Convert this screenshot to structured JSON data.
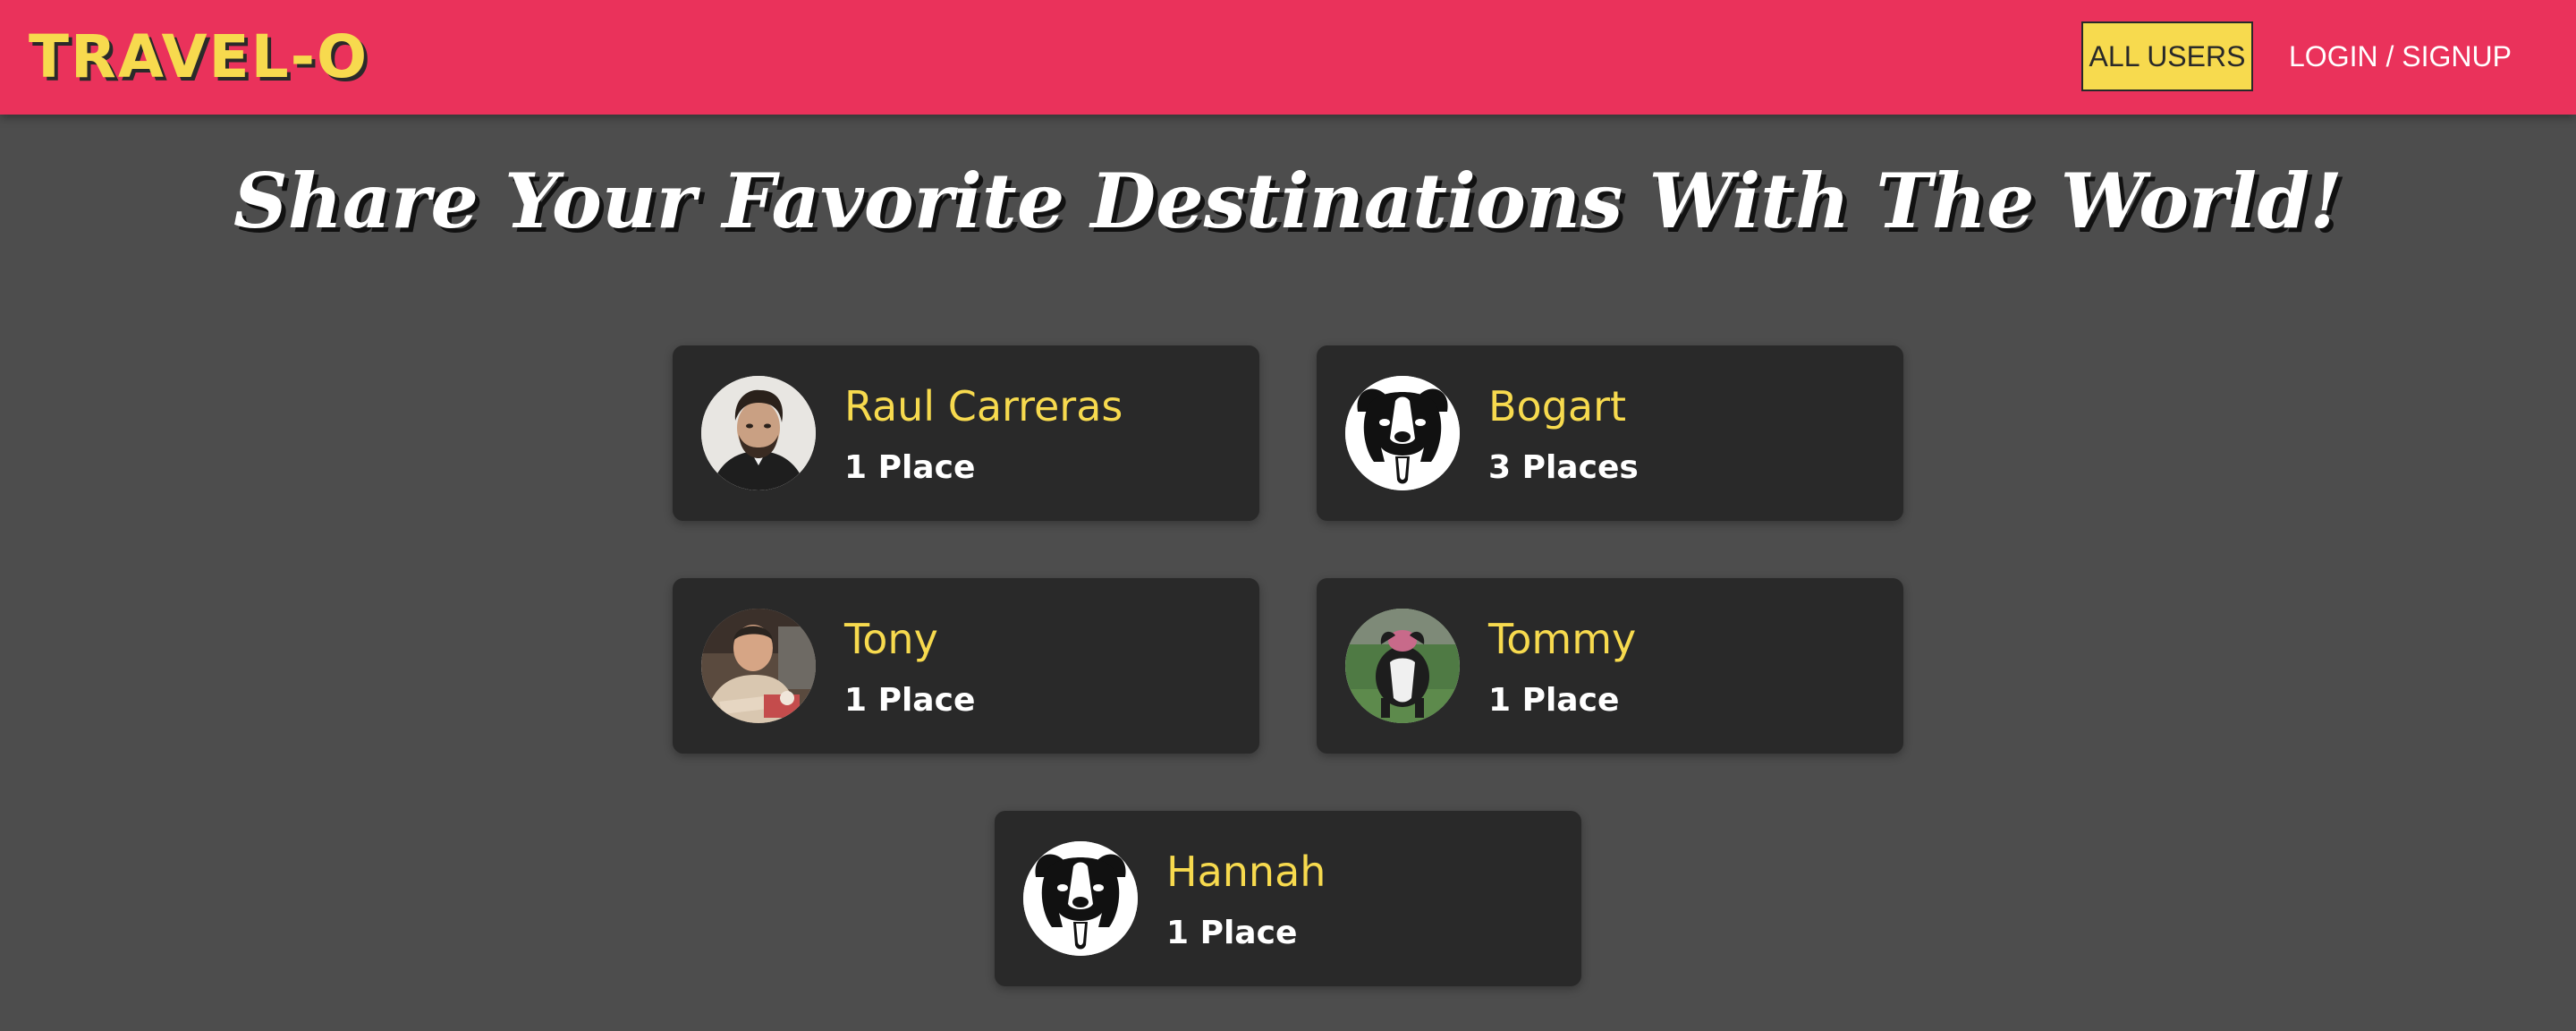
{
  "header": {
    "logo": "TRAVEL-O",
    "nav": {
      "all_users": "ALL USERS",
      "login_signup": "LOGIN / SIGNUP"
    }
  },
  "main": {
    "title": "Share Your Favorite Destinations With The World!",
    "users": [
      {
        "name": "Raul Carreras",
        "places": "1 Place",
        "avatar": "man-photo"
      },
      {
        "name": "Bogart",
        "places": "3 Places",
        "avatar": "dog-logo"
      },
      {
        "name": "Tony",
        "places": "1 Place",
        "avatar": "man-photo"
      },
      {
        "name": "Tommy",
        "places": "1 Place",
        "avatar": "dog-photo"
      },
      {
        "name": "Hannah",
        "places": "1 Place",
        "avatar": "dog-logo"
      }
    ]
  },
  "colors": {
    "header_bg": "#ea325b",
    "accent_yellow": "#f7da4e",
    "page_bg": "#4d4d4d",
    "card_bg": "#292929"
  }
}
